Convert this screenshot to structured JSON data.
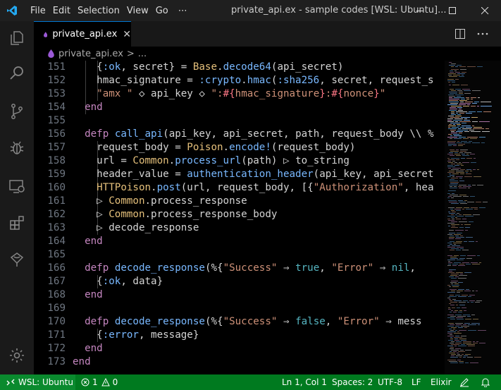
{
  "titlebar": {
    "menu": [
      "File",
      "Edit",
      "Selection",
      "View",
      "Go",
      "⋯"
    ],
    "title": "private_api.ex - sample codes [WSL: Ubuntu]...",
    "controls": [
      "minimize",
      "maximize",
      "close"
    ]
  },
  "activity_bar": [
    "explorer-icon",
    "search-icon",
    "source-control-icon",
    "run-debug-icon",
    "remote-explorer-icon",
    "extensions-icon",
    "docker-icon",
    "settings-gear-icon"
  ],
  "tab": {
    "label": "private_api.ex",
    "close": "✕"
  },
  "breadcrumb": {
    "file": "private_api.ex",
    "sep": ">",
    "rest": "..."
  },
  "editor": {
    "lines": [
      {
        "n": "151",
        "t": "    {:ok, secret} = Base.decode64(api_secret)"
      },
      {
        "n": "152",
        "t": "    hmac_signature = :crypto.hmac(:sha256, secret, request_s"
      },
      {
        "n": "153",
        "t": "    \"amx \" <> api_key <> \":#{hmac_signature}:#{nonce}\""
      },
      {
        "n": "154",
        "t": "  end"
      },
      {
        "n": "155",
        "t": ""
      },
      {
        "n": "156",
        "t": "  defp call_api(api_key, api_secret, path, request_body \\\\ %"
      },
      {
        "n": "157",
        "t": "    request_body = Poison.encode!(request_body)"
      },
      {
        "n": "158",
        "t": "    url = Common.process_url(path) |> to_string"
      },
      {
        "n": "159",
        "t": "    header_value = authentication_header(api_key, api_secret"
      },
      {
        "n": "160",
        "t": "    HTTPoison.post(url, request_body, [{\"Authorization\", hea"
      },
      {
        "n": "161",
        "t": "    |> Common.process_response"
      },
      {
        "n": "162",
        "t": "    |> Common.process_response_body"
      },
      {
        "n": "163",
        "t": "    |> decode_response"
      },
      {
        "n": "164",
        "t": "  end"
      },
      {
        "n": "165",
        "t": ""
      },
      {
        "n": "166",
        "t": "  defp decode_response(%{\"Success\" => true, \"Error\" => nil,"
      },
      {
        "n": "167",
        "t": "    {:ok, data}"
      },
      {
        "n": "168",
        "t": "  end"
      },
      {
        "n": "169",
        "t": ""
      },
      {
        "n": "170",
        "t": "  defp decode_response(%{\"Success\" => false, \"Error\" => mess"
      },
      {
        "n": "171",
        "t": "    {:error, message}"
      },
      {
        "n": "172",
        "t": "  end"
      },
      {
        "n": "173",
        "t": "end"
      }
    ]
  },
  "statusbar": {
    "remote": "WSL: Ubuntu",
    "errors": "1",
    "warnings": "0",
    "position": "Ln 1, Col 1",
    "spaces": "Spaces: 2",
    "encoding": "UTF-8",
    "eol": "LF",
    "language": "Elixir"
  },
  "colors": {
    "statusbar": "#007a1f",
    "tab_accent": "#0078d4",
    "vscode_blue": "#23a9f2",
    "elixir_purple": "#9b59d6"
  }
}
